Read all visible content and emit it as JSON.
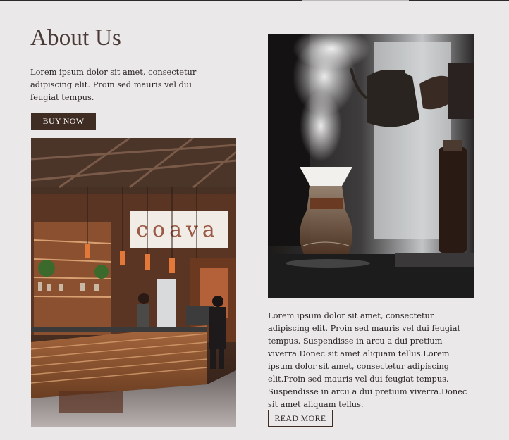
{
  "section": {
    "title": "About Us",
    "intro": "Lorem ipsum dolor sit amet, consectetur adipiscing elit. Proin sed mauris vel dui feugiat tempus.",
    "buy_now_label": "BUY NOW",
    "body": "Lorem ipsum dolor sit amet, consectetur adipiscing elit. Proin sed mauris vel dui feugiat tempus. Suspendisse in arcu a dui pretium viverra.Donec sit amet aliquam tellus.Lorem ipsum dolor sit amet, consectetur adipiscing elit.Proin sed mauris vel dui feugiat tempus. Suspendisse in arcu a dui pretium viverra.Donec sit amet aliquam tellus.",
    "read_more_label": "READ MORE"
  },
  "images": {
    "cafe_sign": "coava"
  },
  "colors": {
    "background": "#ebe8ea",
    "heading": "#4a3a37",
    "button_fill": "#3f2c22",
    "text": "#2a2424"
  }
}
